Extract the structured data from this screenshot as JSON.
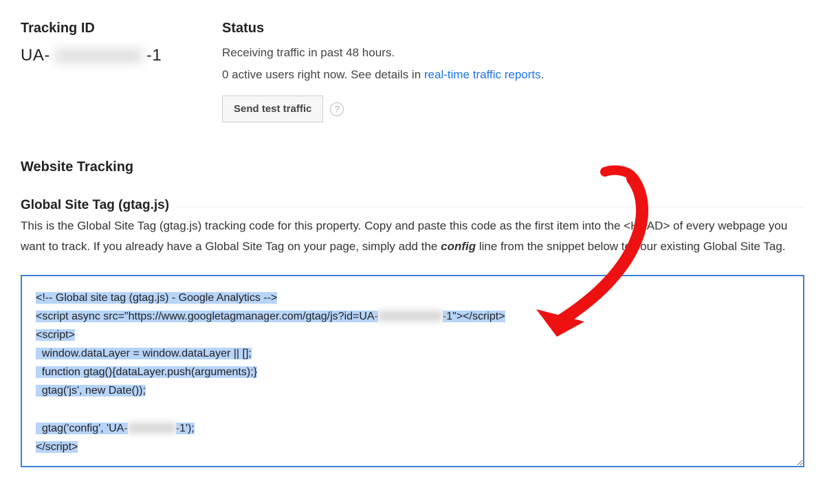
{
  "tracking": {
    "heading": "Tracking ID",
    "id_prefix": "UA-",
    "id_suffix": "-1"
  },
  "status": {
    "heading": "Status",
    "line1": "Receiving traffic in past 48 hours.",
    "line2_prefix": "0 active users right now. See details in ",
    "link_text": "real-time traffic reports",
    "button_label": "Send test traffic"
  },
  "website_tracking": {
    "heading": "Website Tracking",
    "sub_heading": "Global Site Tag (gtag.js)",
    "desc_part1": "This is the Global Site Tag (gtag.js) tracking code for this property. Copy and paste this code as the first item into the <HEAD> of every webpage you want to track. If you already have a Global Site Tag on your page, simply add the ",
    "config_word": "config",
    "desc_part2": " line from the snippet below to your existing Global Site Tag."
  },
  "code": {
    "l1": "<!-- Global site tag (gtag.js) - Google Analytics -->",
    "l2a": "<script async src=\"https://www.googletagmanager.com/gtag/js?id=UA-",
    "l2b": "-1\"></script>",
    "l3": "<script>",
    "l4": "  window.dataLayer = window.dataLayer || [];",
    "l5": "  function gtag(){dataLayer.push(arguments);}",
    "l6": "  gtag('js', new Date());",
    "l7a": "  gtag('config', 'UA-",
    "l7b": "-1');",
    "l8": "</script>"
  }
}
